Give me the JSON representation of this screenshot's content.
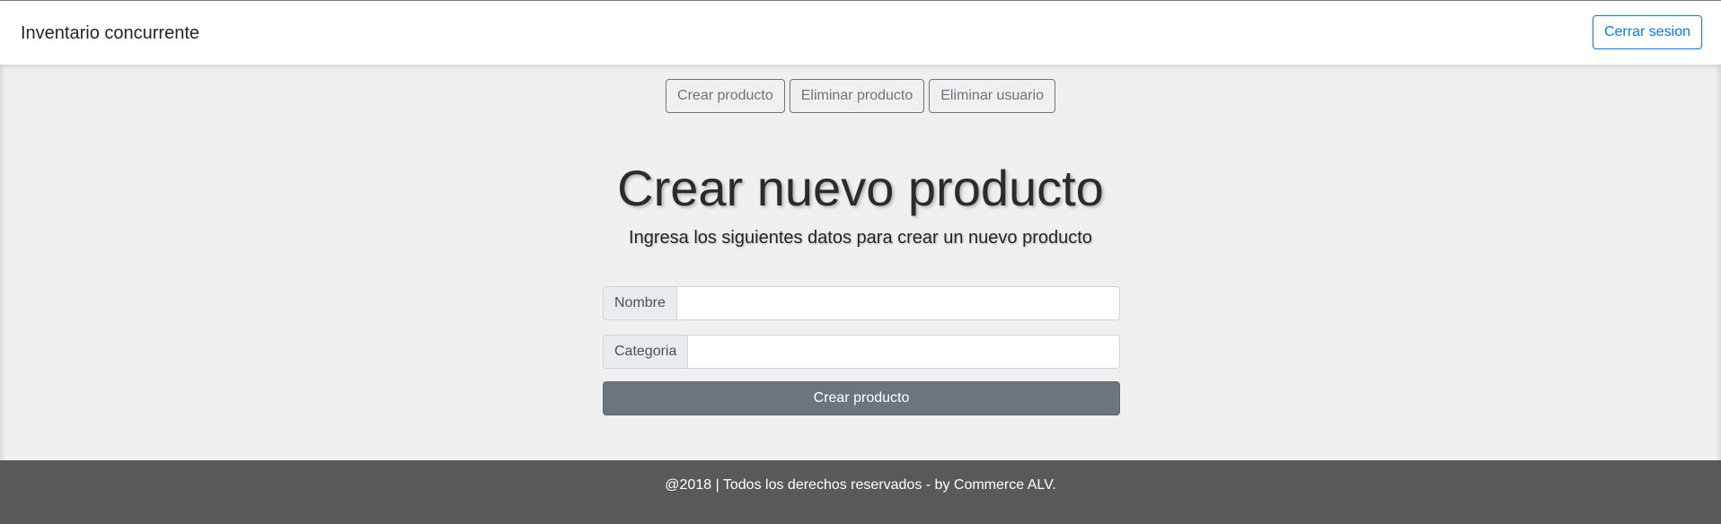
{
  "navbar": {
    "brand": "Inventario concurrente",
    "logout_label": "Cerrar sesion"
  },
  "tabs": [
    {
      "label": "Crear producto"
    },
    {
      "label": "Eliminar producto"
    },
    {
      "label": "Eliminar usuario"
    }
  ],
  "main": {
    "title": "Crear nuevo producto",
    "subtitle": "Ingresa los siguientes datos para crear un nuevo producto"
  },
  "form": {
    "name_label": "Nombre",
    "name_value": "",
    "category_label": "Categoria",
    "category_value": "",
    "submit_label": "Crear producto"
  },
  "footer": {
    "text": "@2018 | Todos los derechos reservados - by Commerce ALV."
  },
  "colors": {
    "primary": "#007bff",
    "secondary": "#6c757d",
    "footer_bg": "#595959",
    "main_bg": "#f0f0f0"
  }
}
